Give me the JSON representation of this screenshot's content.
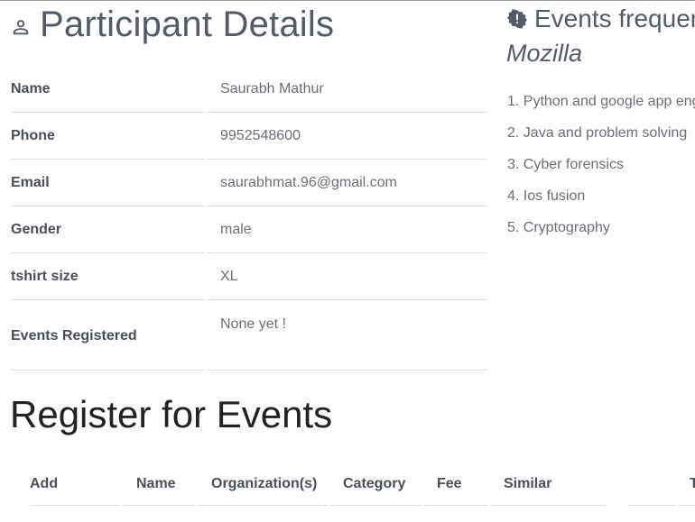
{
  "participant": {
    "title": "Participant Details",
    "rows": [
      {
        "label": "Name",
        "value": "Saurabh Mathur"
      },
      {
        "label": "Phone",
        "value": "9952548600"
      },
      {
        "label": "Email",
        "value": "saurabhmat.96@gmail.com"
      },
      {
        "label": "Gender",
        "value": "male"
      },
      {
        "label": "tshirt size",
        "value": "XL"
      },
      {
        "label": "Events Registered",
        "value": "None yet !"
      }
    ]
  },
  "register": {
    "title": "Register for Events",
    "columns": [
      "Add",
      "Name",
      "Organization(s)",
      "Category",
      "Fee",
      "Similar",
      "T"
    ]
  },
  "frequent": {
    "title": "Events frequer",
    "organization": "Mozilla",
    "items": [
      "1. Python and google app eng",
      "2. Java and problem solving",
      "3. Cyber forensics",
      "4. Ios fusion",
      "5. Cryptography"
    ]
  },
  "icons": {
    "title_icon": "person-icon",
    "events_icon": "badge-icon"
  },
  "colors": {
    "heading": "#555b66",
    "label": "#4a4f57",
    "value": "#6b6f75",
    "divider": "#dddddd"
  }
}
